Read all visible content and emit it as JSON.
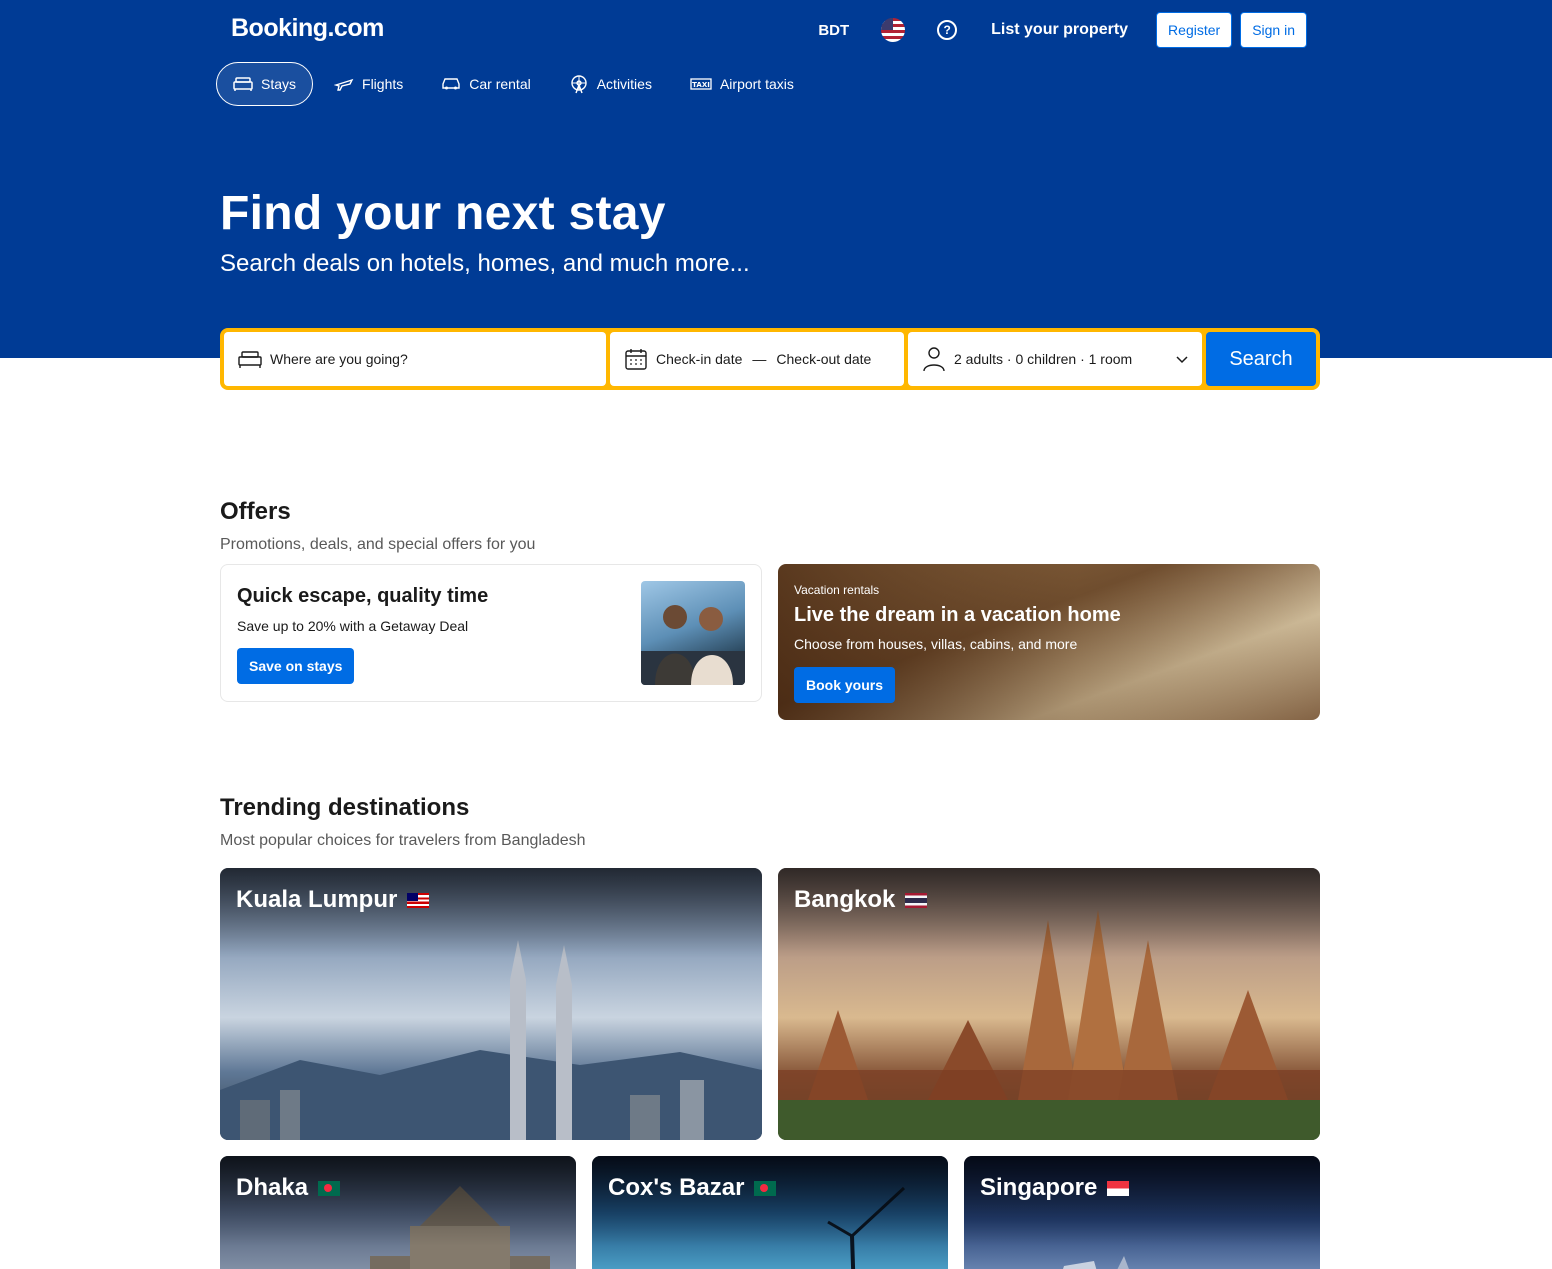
{
  "header": {
    "logo": "Booking.com",
    "currency": "BDT",
    "language_flag": "us-flag-icon",
    "help_icon": "help-icon",
    "list_property": "List your property",
    "register": "Register",
    "sign_in": "Sign in"
  },
  "nav": {
    "tabs": [
      {
        "label": "Stays",
        "icon": "bed-icon",
        "active": true
      },
      {
        "label": "Flights",
        "icon": "plane-icon",
        "active": false
      },
      {
        "label": "Car rental",
        "icon": "car-icon",
        "active": false
      },
      {
        "label": "Activities",
        "icon": "ferris-wheel-icon",
        "active": false
      },
      {
        "label": "Airport taxis",
        "icon": "taxi-icon",
        "active": false
      }
    ]
  },
  "hero": {
    "title": "Find your next stay",
    "subtitle": "Search deals on hotels, homes, and much more..."
  },
  "search": {
    "destination_placeholder": "Where are you going?",
    "checkin": "Check-in date",
    "dash": "—",
    "checkout": "Check-out date",
    "occupancy": "2 adults · 0 children · 1 room",
    "button": "Search"
  },
  "offers": {
    "title": "Offers",
    "subtitle": "Promotions, deals, and special offers for you",
    "cards": [
      {
        "title": "Quick escape, quality time",
        "description": "Save up to 20% with a Getaway Deal",
        "button": "Save on stays"
      },
      {
        "kicker": "Vacation rentals",
        "title": "Live the dream in a vacation home",
        "description": "Choose from houses, villas, cabins, and more",
        "button": "Book yours"
      }
    ]
  },
  "trending": {
    "title": "Trending destinations",
    "subtitle": "Most popular choices for travelers from Bangladesh",
    "destinations": [
      {
        "name": "Kuala Lumpur",
        "flag": "malaysia-flag-icon"
      },
      {
        "name": "Bangkok",
        "flag": "thailand-flag-icon"
      },
      {
        "name": "Dhaka",
        "flag": "bangladesh-flag-icon"
      },
      {
        "name": "Cox's Bazar",
        "flag": "bangladesh-flag-icon"
      },
      {
        "name": "Singapore",
        "flag": "singapore-flag-icon"
      }
    ]
  },
  "colors": {
    "brand_blue": "#003b95",
    "action_blue": "#006ce4",
    "search_border": "#ffb700"
  }
}
